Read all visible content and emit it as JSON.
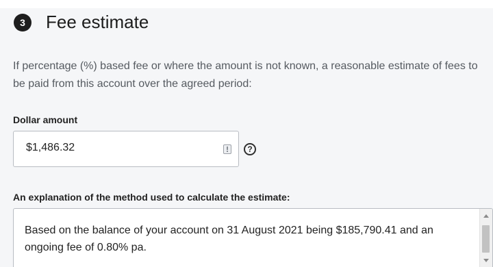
{
  "section": {
    "step_number": "3",
    "title": "Fee estimate",
    "description": "If percentage (%) based fee or where the amount is not known, a reasonable estimate of fees to be paid from this account over the agreed period:"
  },
  "dollar_amount": {
    "label": "Dollar amount",
    "value": "$1,486.32",
    "input_icon": "calculator-icon",
    "help_icon_glyph": "?"
  },
  "explanation": {
    "label": "An explanation of the method used to calculate the estimate:",
    "text": "Based on the balance of your account on 31 August 2021 being $185,790.41 and an ongoing fee of 0.80% pa."
  }
}
